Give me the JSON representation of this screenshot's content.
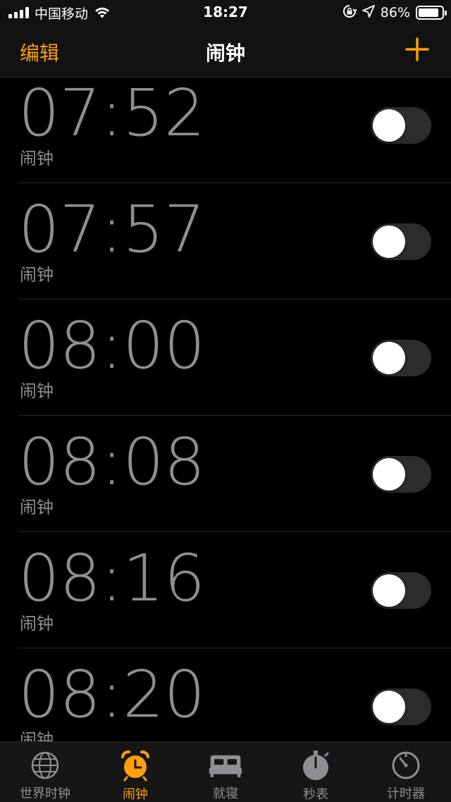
{
  "status_bar": {
    "carrier": "中国移动",
    "time": "18:27",
    "battery_percent": "86%",
    "battery_level": 0.86,
    "icons": [
      "signal-icon",
      "wifi-icon",
      "orientation-lock-icon",
      "location-icon",
      "battery-icon"
    ]
  },
  "nav": {
    "edit_label": "编辑",
    "title": "闹钟",
    "add_icon": "plus-icon"
  },
  "alarms": [
    {
      "time": "07:52",
      "label": "闹钟",
      "enabled": false
    },
    {
      "time": "07:57",
      "label": "闹钟",
      "enabled": false
    },
    {
      "time": "08:00",
      "label": "闹钟",
      "enabled": false
    },
    {
      "time": "08:08",
      "label": "闹钟",
      "enabled": false
    },
    {
      "time": "08:16",
      "label": "闹钟",
      "enabled": false
    },
    {
      "time": "08:20",
      "label": "闹钟",
      "enabled": false
    }
  ],
  "tabs": [
    {
      "label": "世界时钟",
      "icon": "globe-icon",
      "active": false
    },
    {
      "label": "闹钟",
      "icon": "alarm-clock-icon",
      "active": true
    },
    {
      "label": "就寝",
      "icon": "bed-icon",
      "active": false
    },
    {
      "label": "秒表",
      "icon": "stopwatch-icon",
      "active": false
    },
    {
      "label": "计时器",
      "icon": "timer-icon",
      "active": false
    }
  ],
  "colors": {
    "accent": "#ff9f0a",
    "background": "#000000",
    "secondary_text": "#8e8e93",
    "toggle_off": "#2c2c2e"
  }
}
